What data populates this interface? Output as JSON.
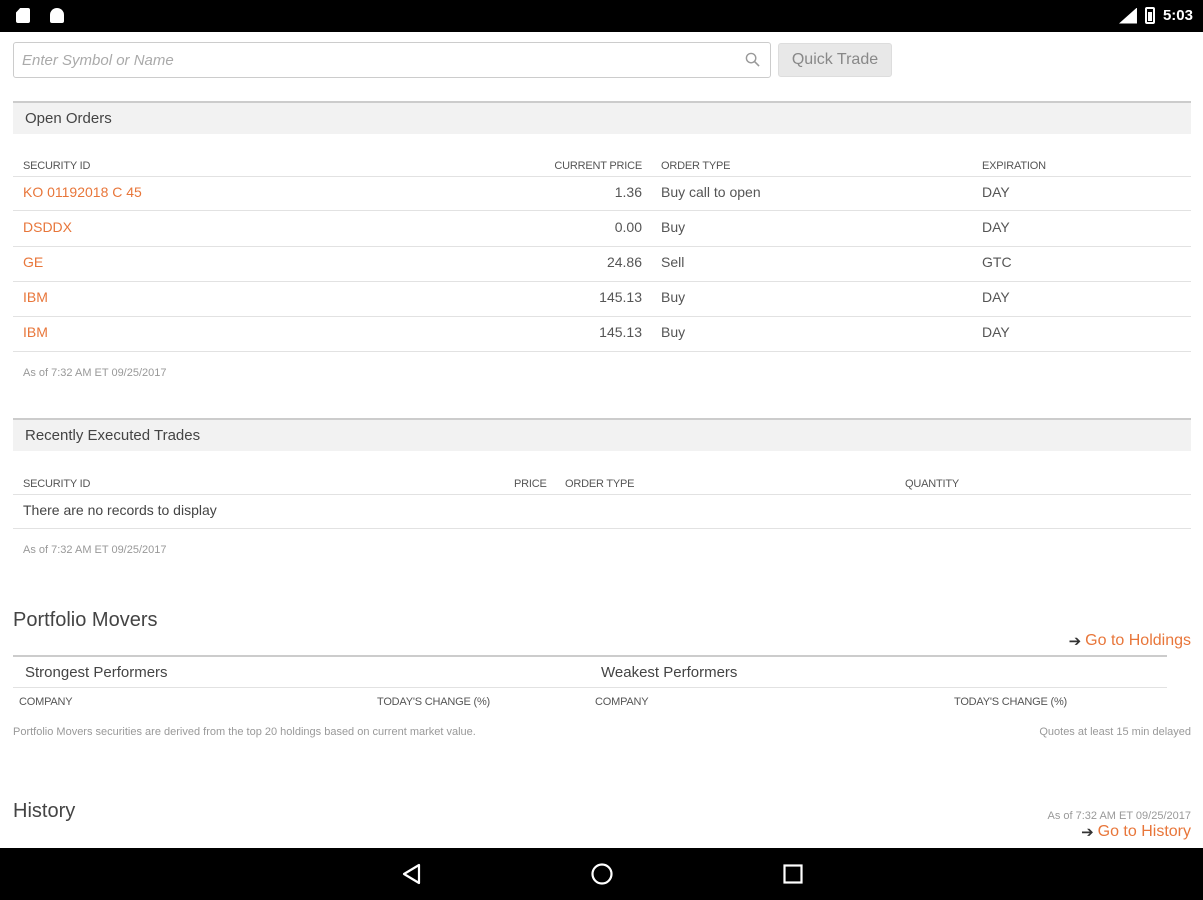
{
  "status_bar": {
    "time": "5:03"
  },
  "search": {
    "placeholder": "Enter Symbol or Name",
    "button_label": "Quick Trade"
  },
  "open_orders": {
    "title": "Open Orders",
    "columns": [
      "SECURITY ID",
      "CURRENT PRICE",
      "ORDER TYPE",
      "EXPIRATION"
    ],
    "rows": [
      {
        "security_id": "KO 01192018 C 45",
        "current_price": "1.36",
        "order_type": "Buy call to open",
        "expiration": "DAY"
      },
      {
        "security_id": "DSDDX",
        "current_price": "0.00",
        "order_type": "Buy",
        "expiration": "DAY"
      },
      {
        "security_id": "GE",
        "current_price": "24.86",
        "order_type": "Sell",
        "expiration": "GTC"
      },
      {
        "security_id": "IBM",
        "current_price": "145.13",
        "order_type": "Buy",
        "expiration": "DAY"
      },
      {
        "security_id": "IBM",
        "current_price": "145.13",
        "order_type": "Buy",
        "expiration": "DAY"
      }
    ],
    "as_of": "As of 7:32 AM ET 09/25/2017"
  },
  "recent_trades": {
    "title": "Recently Executed Trades",
    "columns": [
      "SECURITY ID",
      "PRICE",
      "ORDER TYPE",
      "QUANTITY"
    ],
    "empty_message": "There are no records to display",
    "as_of": "As of 7:32 AM ET 09/25/2017"
  },
  "portfolio_movers": {
    "title": "Portfolio Movers",
    "go_link": "Go to Holdings",
    "strongest": {
      "title": "Strongest Performers",
      "col_company": "COMPANY",
      "col_change": "TODAY'S CHANGE (%)"
    },
    "weakest": {
      "title": "Weakest Performers",
      "col_company": "COMPANY",
      "col_change": "TODAY'S CHANGE (%)"
    },
    "footnote": "Portfolio Movers securities are derived from the top 20 holdings based on current market value.",
    "delay_note": "Quotes at least 15 min delayed"
  },
  "history": {
    "title": "History",
    "as_of": "As of 7:32 AM ET 09/25/2017",
    "go_link": "Go to History"
  },
  "icons": {
    "search": "search-icon",
    "arrow": "arrow-right-icon",
    "back": "back-icon",
    "home": "home-icon",
    "recents": "recents-icon"
  },
  "colors": {
    "accent": "#e8763a"
  }
}
